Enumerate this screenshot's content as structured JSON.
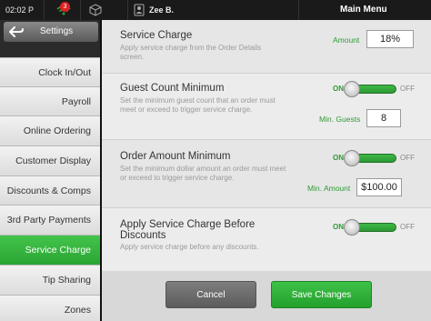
{
  "status_bar": {
    "time": "02:02 P",
    "notification_count": "3",
    "user_name": "Zee B.",
    "menu_title": "Main Menu"
  },
  "sidebar": {
    "settings_label": "Settings",
    "items": [
      {
        "label": "Clock In/Out"
      },
      {
        "label": "Payroll"
      },
      {
        "label": "Online Ordering"
      },
      {
        "label": "Customer Display"
      },
      {
        "label": "Discounts & Comps"
      },
      {
        "label": "3rd Party Payments"
      },
      {
        "label": "Service Charge"
      },
      {
        "label": "Tip Sharing"
      },
      {
        "label": "Zones"
      }
    ]
  },
  "sections": {
    "service_charge": {
      "title": "Service Charge",
      "desc": "Apply service charge from the Order Details screen.",
      "field_label": "Amount",
      "field_value": "18%"
    },
    "guest_count": {
      "title": "Guest Count Minimum",
      "desc": "Set the minimum guest count that an order must meet or exceed to trigger service charge.",
      "toggle_on": "ON",
      "toggle_off": "OFF",
      "field_label": "Min. Guests",
      "field_value": "8"
    },
    "order_amount": {
      "title": "Order Amount Minimum",
      "desc": "Set the minimum dollar amount an order must meet or exceed to trigger service charge.",
      "toggle_on": "ON",
      "toggle_off": "OFF",
      "field_label": "Min. Amount",
      "field_value": "$100.00"
    },
    "before_discounts": {
      "title_line1": "Apply Service Charge Before",
      "title_line2": "Discounts",
      "desc": "Apply service charge before any discounts.",
      "toggle_on": "ON",
      "toggle_off": "OFF"
    }
  },
  "buttons": {
    "cancel": "Cancel",
    "save": "Save Changes"
  },
  "colors": {
    "accent_green": "#2aa534",
    "label_green": "#2e9a35",
    "badge_red": "#dd2222"
  }
}
